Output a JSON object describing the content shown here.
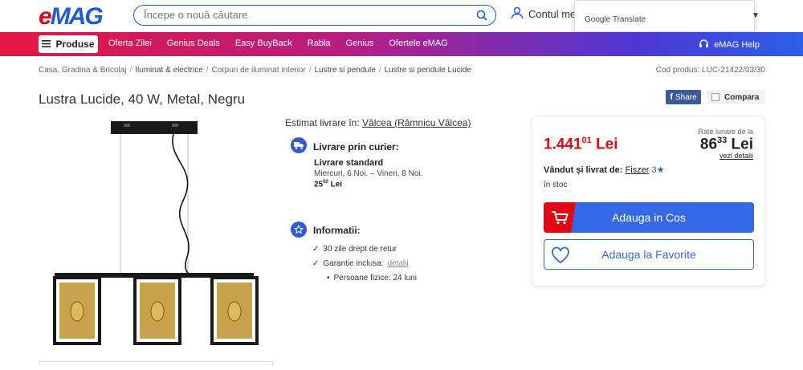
{
  "header": {
    "logo_e": "e",
    "logo_rest": "MAG",
    "search_placeholder": "Începe o nouă căutare",
    "account_label": "Contul me",
    "translate_label": "Google Translate"
  },
  "nav": {
    "produse": "Produse",
    "items": [
      "Oferta Zilei",
      "Genius Deals",
      "Easy BuyBack",
      "Rabla",
      "Genius",
      "Ofertele eMAG"
    ],
    "help": "eMAG Help"
  },
  "breadcrumb": {
    "items": [
      "Casa, Gradina & Bricolaj",
      "Iluminat & electrice",
      "Corpuri de iluminat interior",
      "Lustre si pendule",
      "Lustre si pendule Lucide"
    ],
    "product_code": "Cod produs: LUC-21422/03/30"
  },
  "product": {
    "title": "Lustra Lucide, 40 W, Metal, Negru",
    "share": "Share",
    "compare": "Compara"
  },
  "delivery": {
    "estimate_label": "Estimat livrare în:",
    "location": "Vâlcea (Râmnicu Vâlcea)",
    "courier_heading": "Livrare prin curier:",
    "standard_title": "Livrare standard",
    "standard_dates": "Miercuri, 6 Noi. – Vineri, 8 Noi.",
    "standard_price_main": "25",
    "standard_price_dec": "00",
    "standard_price_cur": "Lei"
  },
  "info": {
    "heading": "Informatii:",
    "return": "30 zile drept de retur",
    "warranty": "Garantie inclusa:",
    "warranty_link": "detalii",
    "warranty_sub": "Persoane fizice: 24 luni"
  },
  "buybox": {
    "price_main": "1.441",
    "price_dec": "01",
    "price_cur": "Lei",
    "rate_label": "Rate lunare de la",
    "rate_main": "86",
    "rate_dec": "33",
    "rate_cur": "Lei",
    "rate_details": "vezi detalii",
    "seller_label": "Vândut și livrat de:",
    "seller_name": "Fiszer",
    "seller_rating": "3",
    "stock": "în stoc",
    "add_to_cart": "Adauga in Cos",
    "add_to_fav": "Adauga la Favorite"
  },
  "colors": {
    "brand_blue": "#2e5cd6",
    "brand_red": "#e30613"
  }
}
